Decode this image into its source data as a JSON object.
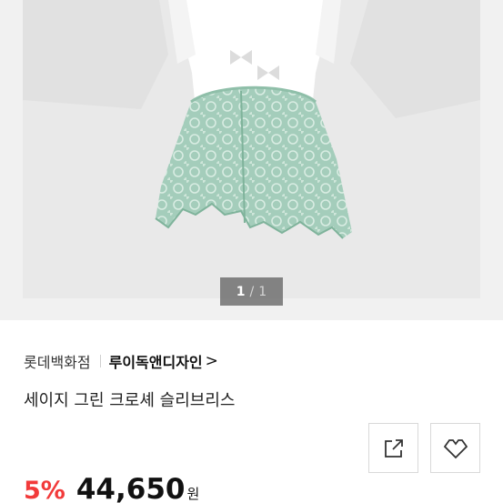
{
  "gallery": {
    "current_page": "1",
    "separator": "/",
    "total_pages": "1",
    "photo_colors": {
      "background": "#e8e8e8",
      "body": "#ffffff",
      "lace": "#9cc8b4",
      "lace_dark": "#7fb39b"
    }
  },
  "product": {
    "store_name": "롯데백화점",
    "brand_name": "루이독앤디자인",
    "brand_chevron": ">",
    "title": "세이지 그린 크로셰 슬리브리스"
  },
  "actions": {
    "share_icon": "share-icon",
    "wishlist_icon": "heart-outline-icon"
  },
  "price": {
    "discount": "5%",
    "amount": "44,650",
    "currency": "원",
    "discount_color": "#f23a3a"
  }
}
